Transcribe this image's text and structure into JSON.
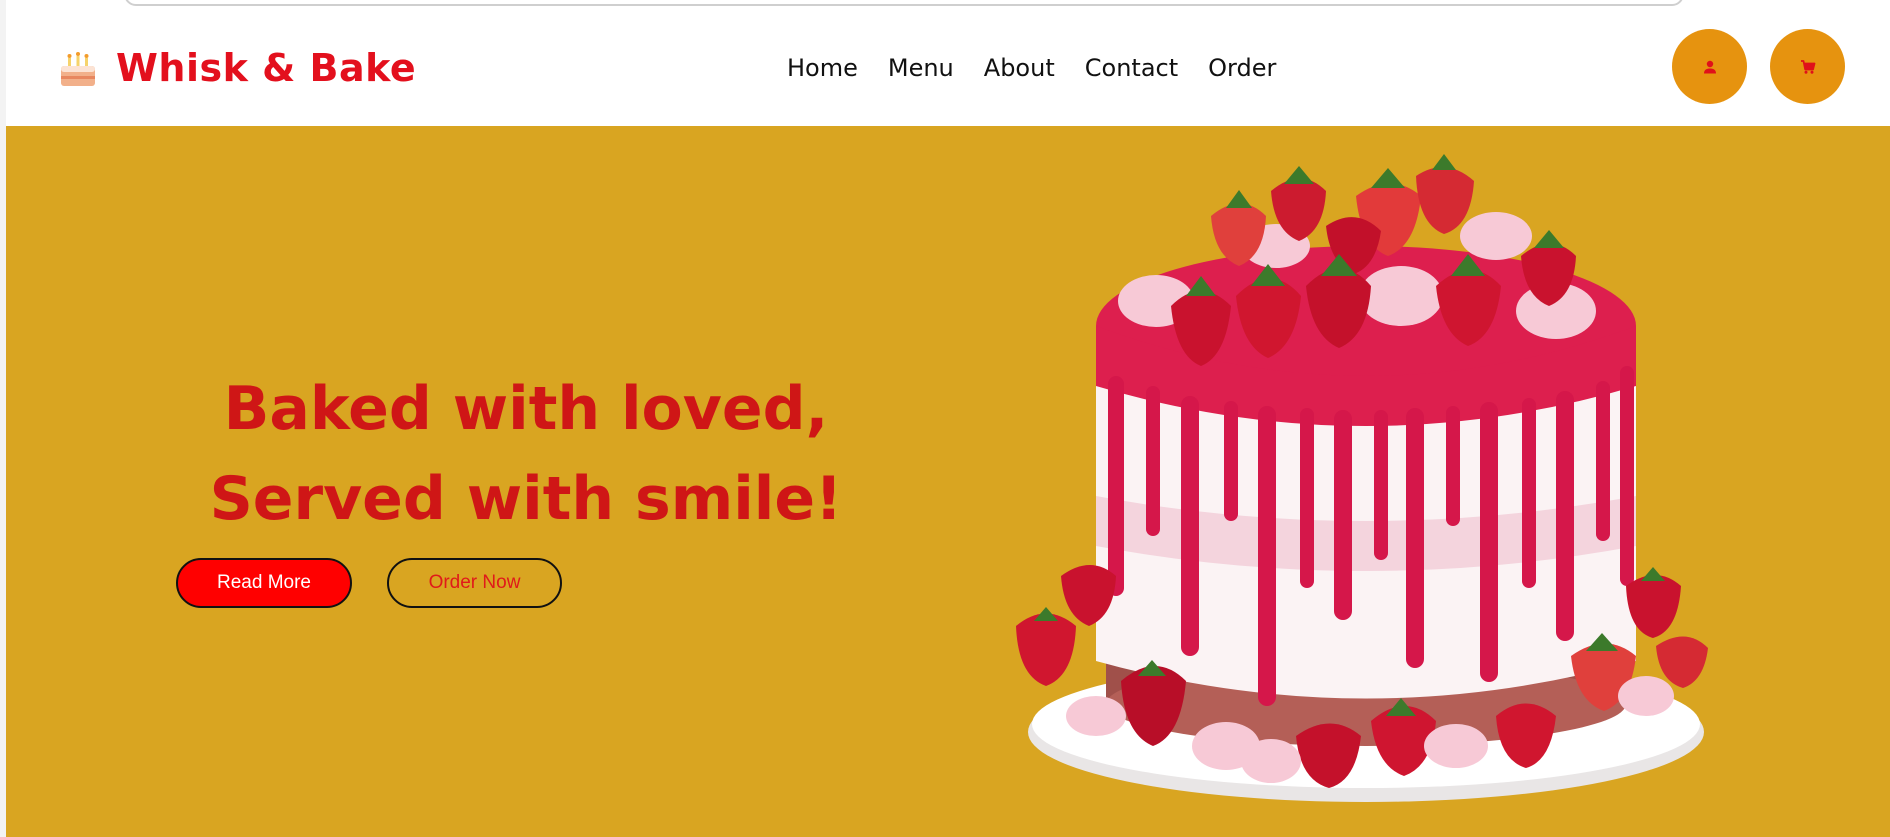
{
  "brand": {
    "icon": "birthday-cake-icon",
    "name": "Whisk & Bake",
    "color": "#e3101d"
  },
  "nav": [
    {
      "label": "Home"
    },
    {
      "label": "Menu"
    },
    {
      "label": "About"
    },
    {
      "label": "Contact"
    },
    {
      "label": "Order"
    }
  ],
  "header_actions": [
    {
      "icon": "user-icon"
    },
    {
      "icon": "shopping-cart-icon"
    }
  ],
  "hero": {
    "line1": "Baked with loved,",
    "line2": "Served with smile!",
    "read_more_label": "Read More",
    "order_now_label": "Order Now",
    "image": "strawberry-drip-cake",
    "background": "#d9a521",
    "headline_color": "#cf1616"
  },
  "colors": {
    "action_circle": "#e6930f",
    "primary_button": "#ff0000"
  }
}
